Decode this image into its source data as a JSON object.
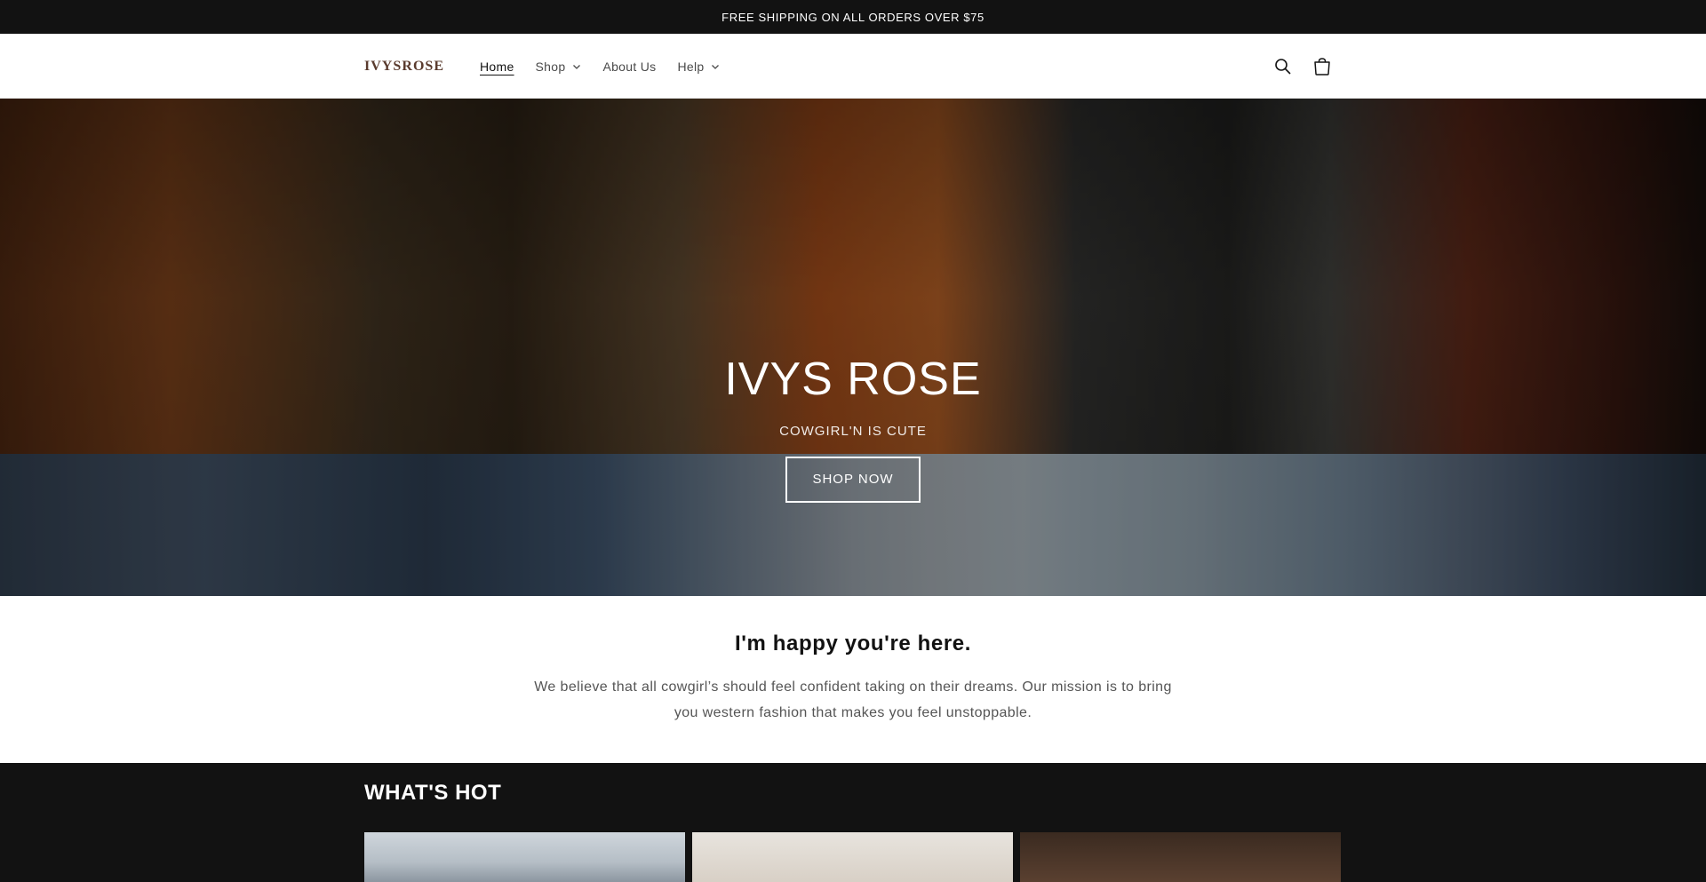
{
  "announcement": {
    "text": "FREE SHIPPING ON ALL ORDERS OVER $75"
  },
  "brand": {
    "logo_text_left": "IVYS",
    "logo_text_right": "ROSE"
  },
  "nav": {
    "items": [
      {
        "label": "Home",
        "active": true
      },
      {
        "label": "Shop",
        "has_dropdown": true
      },
      {
        "label": "About Us"
      },
      {
        "label": "Help",
        "has_dropdown": true
      }
    ]
  },
  "header_icons": [
    "search-icon",
    "cart-icon"
  ],
  "hero": {
    "title": "IVYS ROSE",
    "subtitle": "COWGIRL'N IS CUTE",
    "button_label": "SHOP NOW"
  },
  "intro": {
    "title": "I'm happy you're here.",
    "text": "We believe that all cowgirl’s should feel confident taking on their dreams. Our mission is to bring you western fashion that makes you feel unstoppable."
  },
  "whats_hot": {
    "title": "WHAT'S HOT"
  },
  "colors": {
    "announcement_bg": "#121212",
    "logo_brown": "#5a3b2e",
    "section_dark": "#121212"
  }
}
